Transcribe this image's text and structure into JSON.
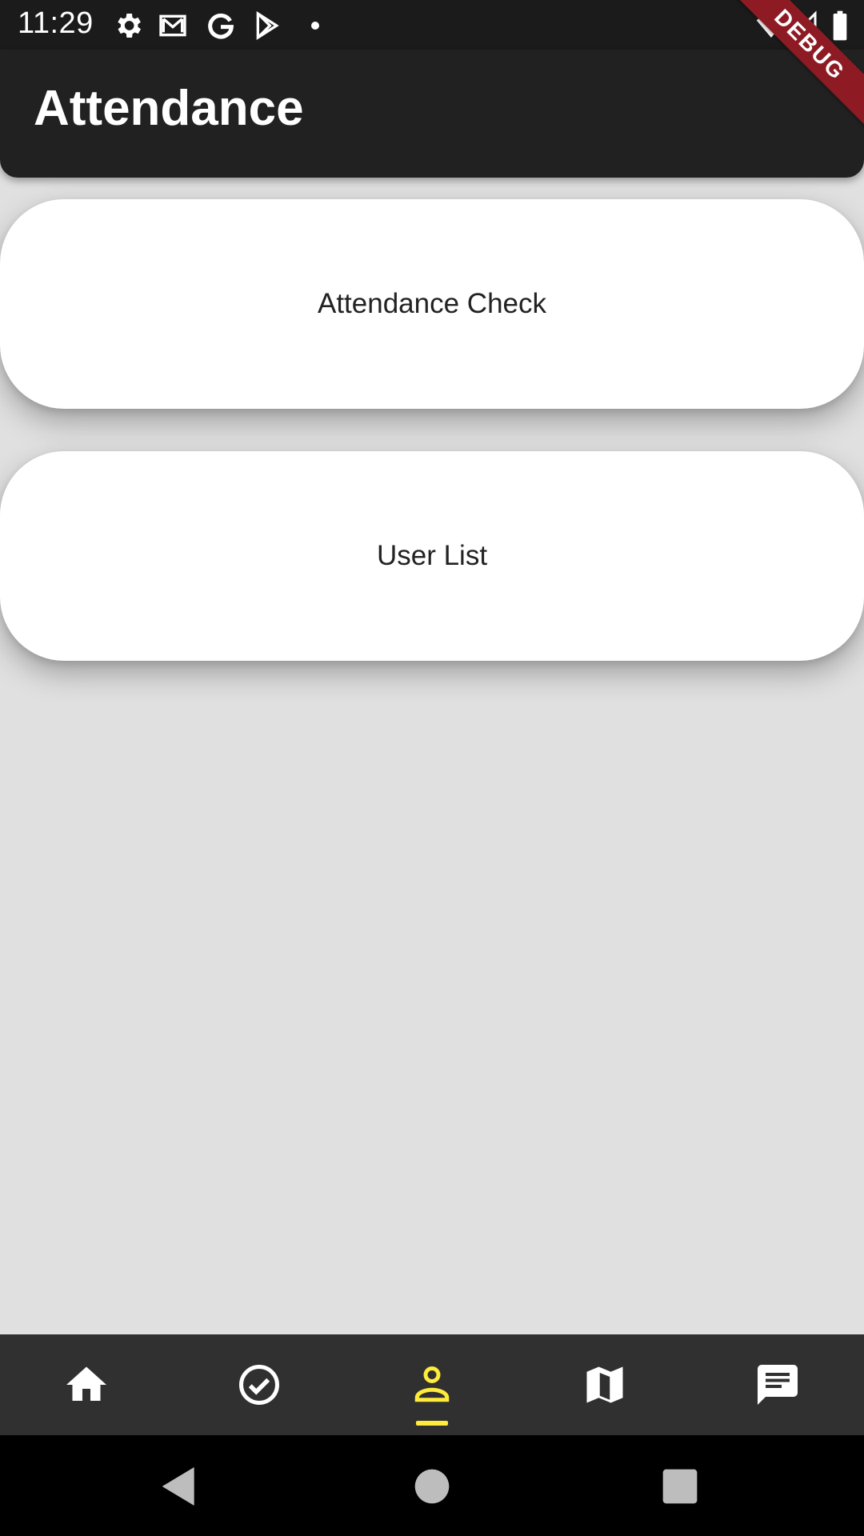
{
  "status_bar": {
    "time": "11:29",
    "icons": [
      "gear-icon",
      "gmail-icon",
      "google-icon",
      "play-store-icon",
      "dot-icon",
      "wifi-icon",
      "signal-icon",
      "battery-icon"
    ]
  },
  "debug_banner": {
    "label": "DEBUG"
  },
  "app_bar": {
    "title": "Attendance"
  },
  "cards": [
    {
      "label": "Attendance Check"
    },
    {
      "label": "User List"
    }
  ],
  "bottom_nav": {
    "items": [
      "home-icon",
      "check-circle-icon",
      "person-icon",
      "map-icon",
      "chat-icon"
    ],
    "selected_index": 2,
    "selected_color": "#ffeb3b",
    "icon_color": "#ffffff"
  },
  "system_nav": {
    "buttons": [
      "back-icon",
      "home-circle-icon",
      "recents-icon"
    ]
  },
  "colors": {
    "app_bar": "#212121",
    "background": "#e0e0e0",
    "card": "#ffffff",
    "nav_bar": "#303030",
    "debug": "#8e1b24"
  }
}
